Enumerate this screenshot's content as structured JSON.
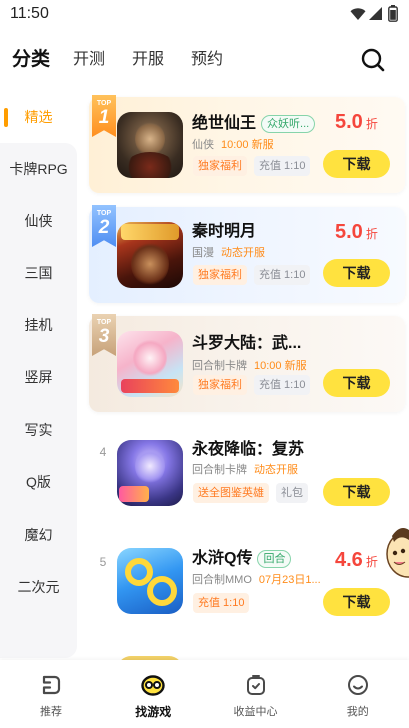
{
  "status_bar": {
    "time": "11:50"
  },
  "header": {
    "tabs": [
      {
        "label": "分类",
        "active": true
      },
      {
        "label": "开测",
        "active": false
      },
      {
        "label": "开服",
        "active": false
      },
      {
        "label": "预约",
        "active": false
      }
    ],
    "search_icon": "search-icon"
  },
  "sidebar": {
    "items": [
      {
        "label": "精选",
        "active": true
      },
      {
        "label": "卡牌RPG"
      },
      {
        "label": "仙侠"
      },
      {
        "label": "三国"
      },
      {
        "label": "挂机"
      },
      {
        "label": "竖屏"
      },
      {
        "label": "写实"
      },
      {
        "label": "Q版"
      },
      {
        "label": "魔幻"
      },
      {
        "label": "二次元"
      }
    ]
  },
  "games": [
    {
      "badge": {
        "text": "TOP",
        "rank": "1"
      },
      "title": "绝世仙王",
      "tag": "众妖听...",
      "genre": "仙侠",
      "server": "10:00 新服",
      "perks": [
        "独家福利",
        "充值 1:10"
      ],
      "discount": "5.0",
      "discount_unit": "折",
      "action": "下载"
    },
    {
      "badge": {
        "text": "TOP",
        "rank": "2"
      },
      "title": "秦时明月",
      "genre": "国漫",
      "server": "动态开服",
      "perks": [
        "独家福利",
        "充值 1:10"
      ],
      "discount": "5.0",
      "discount_unit": "折",
      "action": "下载"
    },
    {
      "badge": {
        "text": "TOP",
        "rank": "3"
      },
      "title": "斗罗大陆：武...",
      "genre": "回合制卡牌",
      "server": "10:00 新服",
      "perks": [
        "独家福利",
        "充值 1:10"
      ],
      "action": "下载"
    },
    {
      "rank": "4",
      "title": "永夜降临：复苏",
      "genre": "回合制卡牌",
      "server": "动态开服",
      "perks": [
        "送全图鉴英雄",
        "礼包"
      ],
      "action": "下载"
    },
    {
      "rank": "5",
      "title": "水浒Q传",
      "tag": "回合",
      "genre": "回合制MMO",
      "server": "07月23日1...",
      "perks": [
        "充值 1:10"
      ],
      "discount": "4.6",
      "discount_unit": "折",
      "action": "下载"
    }
  ],
  "bottom_nav": [
    {
      "label": "推荐",
      "icon": "recommend-icon",
      "active": false
    },
    {
      "label": "找游戏",
      "icon": "gamepad-icon",
      "active": true
    },
    {
      "label": "收益中心",
      "icon": "earnings-icon",
      "active": false
    },
    {
      "label": "我的",
      "icon": "profile-icon",
      "active": false
    }
  ],
  "colors": {
    "accent": "#ff9d00",
    "discount": "#f5463c",
    "download_button": "#ffe23f",
    "highlight_text": "#ff8c1a",
    "tag_green": "#34a86b"
  }
}
